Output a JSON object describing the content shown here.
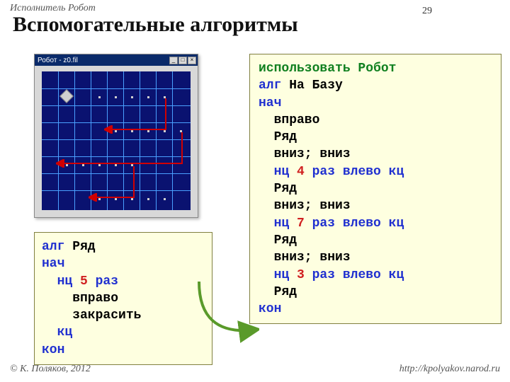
{
  "top_label": "Исполнитель Робот",
  "page_number": "29",
  "title": "Вспомогательные алгоритмы",
  "robot_window": {
    "title": "Робот - z0.fil",
    "min": "_",
    "max": "□",
    "close": "×"
  },
  "code_left": {
    "l1_alg": "алг",
    "l1_name": " Ряд",
    "l2": "нач",
    "l3_nc": "  нц",
    "l3_num": " 5",
    "l3_raz": " раз",
    "l4": "    вправо",
    "l5": "    закрасить",
    "l6": "  кц",
    "l7": "кон"
  },
  "code_right": {
    "l1_use": "использовать",
    "l1_robot": " Робот",
    "l2_alg": "алг",
    "l2_name": " На Базу",
    "l3": "нач",
    "l4": "  вправо",
    "l5": "  Ряд",
    "l6": "  вниз; вниз",
    "l7_nc": "  нц",
    "l7_num": " 4",
    "l7_raz": " раз влево",
    "l7_kc": " кц",
    "l8": "  Ряд",
    "l9": "  вниз; вниз",
    "l10_nc": "  нц",
    "l10_num": " 7",
    "l10_raz": " раз влево",
    "l10_kc": " кц",
    "l11": "  Ряд",
    "l12": "  вниз; вниз",
    "l13_nc": "  нц",
    "l13_num": " 3",
    "l13_raz": " раз влево",
    "l13_kc": " кц",
    "l14": "  Ряд",
    "l15": "кон"
  },
  "footer_left": "© К. Поляков, 2012",
  "footer_right": "http://kpolyakov.narod.ru"
}
